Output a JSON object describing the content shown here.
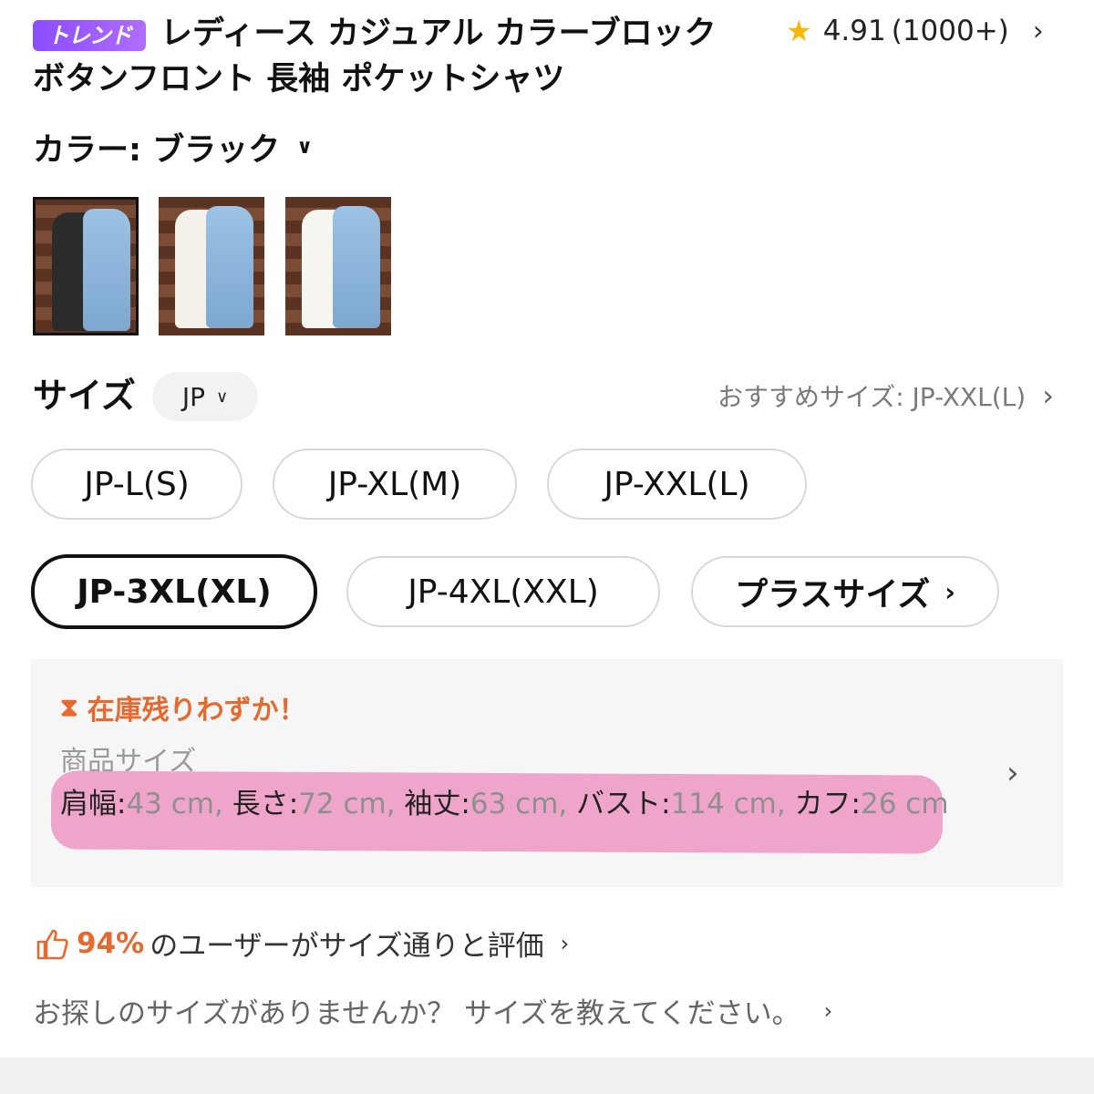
{
  "header": {
    "badge": "トレンド",
    "title": "レディース カジュアル カラーブロック ボタンフロント 長袖 ポケットシャツ",
    "rating": "4.91",
    "review_count": "(1000+)"
  },
  "color": {
    "label": "カラー: ブラック",
    "options": [
      {
        "name": "black",
        "shirt_color": "#2b2b2b",
        "selected": true
      },
      {
        "name": "white",
        "shirt_color": "#f4f1ea",
        "selected": false
      },
      {
        "name": "white-2",
        "shirt_color": "#f7f5f0",
        "selected": false
      }
    ]
  },
  "size": {
    "label": "サイズ",
    "region": "JP",
    "recommended": "おすすめサイズ: JP-XXL(L)",
    "options": [
      {
        "label": "JP-L(S)",
        "selected": false
      },
      {
        "label": "JP-XL(M)",
        "selected": false
      },
      {
        "label": "JP-XXL(L)",
        "selected": false
      },
      {
        "label": "JP-3XL(XL)",
        "selected": true
      },
      {
        "label": "JP-4XL(XXL)",
        "selected": false
      },
      {
        "label": "プラスサイズ",
        "selected": false
      }
    ]
  },
  "stock": {
    "warning": "在庫残りわずか！",
    "spec_title": "商品サイズ",
    "specs": [
      {
        "key": "肩幅:",
        "value": "43 cm, "
      },
      {
        "key": "長さ:",
        "value": "72 cm, "
      },
      {
        "key": "袖丈:",
        "value": "63 cm, "
      },
      {
        "key": "バスト:",
        "value": "114 cm, "
      },
      {
        "key": "カフ:",
        "value": "26 cm"
      }
    ]
  },
  "fit": {
    "percent": "94%",
    "text": "のユーザーがサイズ通りと評価"
  },
  "ask": "お探しのサイズがありませんか？ サイズを教えてください。",
  "colors": {
    "accent": "#e46a30",
    "badge": "#8a4dff",
    "highlight": "#eea0c6"
  }
}
